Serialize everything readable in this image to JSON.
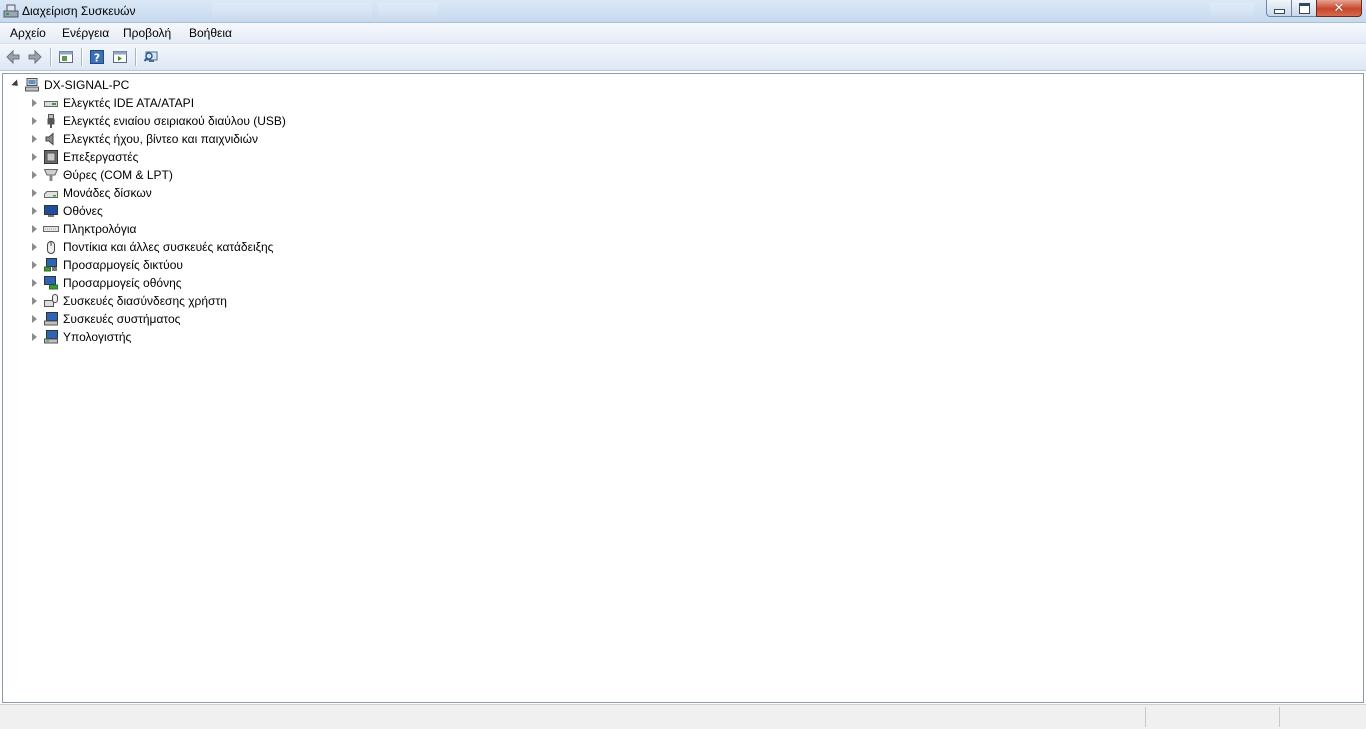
{
  "window": {
    "title": "Διαχείριση Συσκευών"
  },
  "menu": [
    {
      "label": "Αρχείο"
    },
    {
      "label": "Ενέργεια"
    },
    {
      "label": "Προβολή"
    },
    {
      "label": "Βοήθεια"
    }
  ],
  "toolbar": {
    "buttons": [
      {
        "icon": "back-arrow-icon"
      },
      {
        "icon": "forward-arrow-icon"
      },
      {
        "icon": "properties-sheet-icon"
      },
      {
        "icon": "help-icon"
      },
      {
        "icon": "console-tree-icon"
      },
      {
        "icon": "scan-hardware-icon"
      }
    ]
  },
  "tree": {
    "root": {
      "label": "DX-SIGNAL-PC",
      "icon": "computer-icon",
      "expanded": true
    },
    "categories": [
      {
        "label": "Ελεγκτές IDE ATA/ATAPI",
        "icon": "ide-controller-icon"
      },
      {
        "label": "Ελεγκτές ενιαίου σειριακού διαύλου (USB)",
        "icon": "usb-icon"
      },
      {
        "label": "Ελεγκτές ήχου, βίντεο και παιχνιδιών",
        "icon": "speaker-icon"
      },
      {
        "label": "Επεξεργαστές",
        "icon": "cpu-icon"
      },
      {
        "label": "Θύρες (COM & LPT)",
        "icon": "port-icon"
      },
      {
        "label": "Μονάδες δίσκων",
        "icon": "disk-drive-icon"
      },
      {
        "label": "Οθόνες",
        "icon": "monitor-icon"
      },
      {
        "label": "Πληκτρολόγια",
        "icon": "keyboard-icon"
      },
      {
        "label": "Ποντίκια και άλλες συσκευές κατάδειξης",
        "icon": "mouse-icon"
      },
      {
        "label": "Προσαρμογείς δικτύου",
        "icon": "network-adapter-icon"
      },
      {
        "label": "Προσαρμογείς οθόνης",
        "icon": "display-adapter-icon"
      },
      {
        "label": "Συσκευές διασύνδεσης χρήστη",
        "icon": "hid-icon"
      },
      {
        "label": "Συσκευές συστήματος",
        "icon": "system-devices-icon"
      },
      {
        "label": "Υπολογιστής",
        "icon": "computer-icon"
      }
    ]
  },
  "colors": {
    "titlebar": "#c6d9ee",
    "close_button": "#c7462c",
    "tree_background": "#ffffff",
    "statusbar": "#f0f0f0"
  }
}
